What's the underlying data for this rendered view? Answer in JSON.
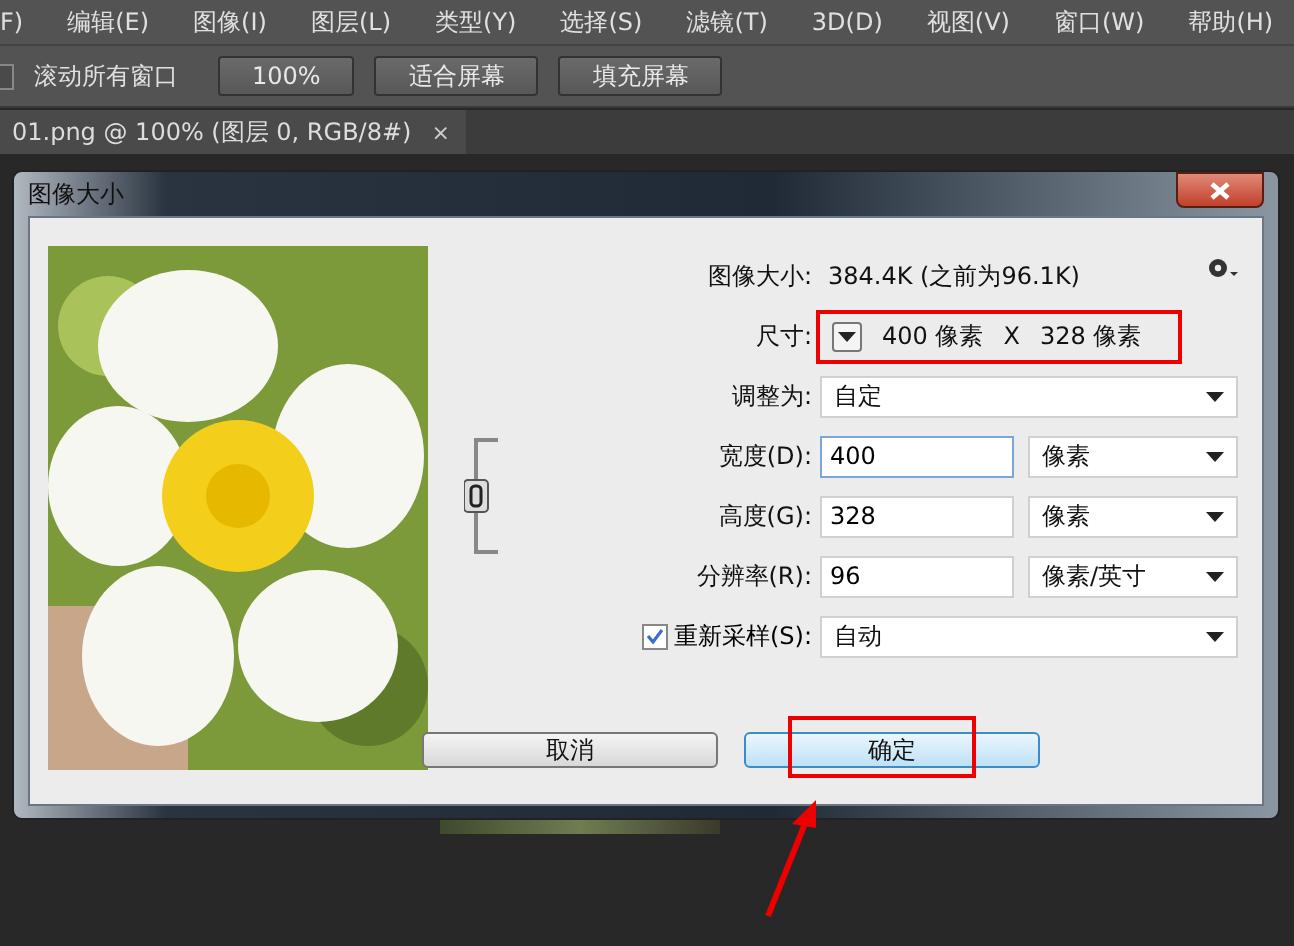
{
  "menu_bar": {
    "items": [
      "F)",
      "编辑(E)",
      "图像(I)",
      "图层(L)",
      "类型(Y)",
      "选择(S)",
      "滤镜(T)",
      "3D(D)",
      "视图(V)",
      "窗口(W)",
      "帮助(H)"
    ]
  },
  "toolbar": {
    "scroll_all": {
      "label": "滚动所有窗口",
      "checked": false
    },
    "buttons": [
      "100%",
      "适合屏幕",
      "填充屏幕"
    ]
  },
  "document_tab": {
    "title": "01.png @ 100% (图层 0, RGB/8#)",
    "close": "×"
  },
  "dialog": {
    "title": "图像大小",
    "image_size": {
      "label": "图像大小:",
      "value": "384.4K (之前为96.1K)"
    },
    "dimensions": {
      "label": "尺寸:",
      "width": "400 像素",
      "x": "X",
      "height": "328 像素",
      "highlighted": true
    },
    "fit_to": {
      "label": "调整为:",
      "value": "自定"
    },
    "fields": [
      {
        "label": "宽度(D):",
        "value": "400",
        "unit": "像素"
      },
      {
        "label": "高度(G):",
        "value": "328",
        "unit": "像素"
      },
      {
        "label": "分辨率(R):",
        "value": "96",
        "unit": "像素/英寸"
      }
    ],
    "resample": {
      "label": "重新采样(S):",
      "checked": true,
      "value": "自动"
    },
    "buttons": [
      {
        "label": "取消",
        "default": false,
        "highlighted": false
      },
      {
        "label": "确定",
        "default": true,
        "highlighted": true
      }
    ]
  }
}
